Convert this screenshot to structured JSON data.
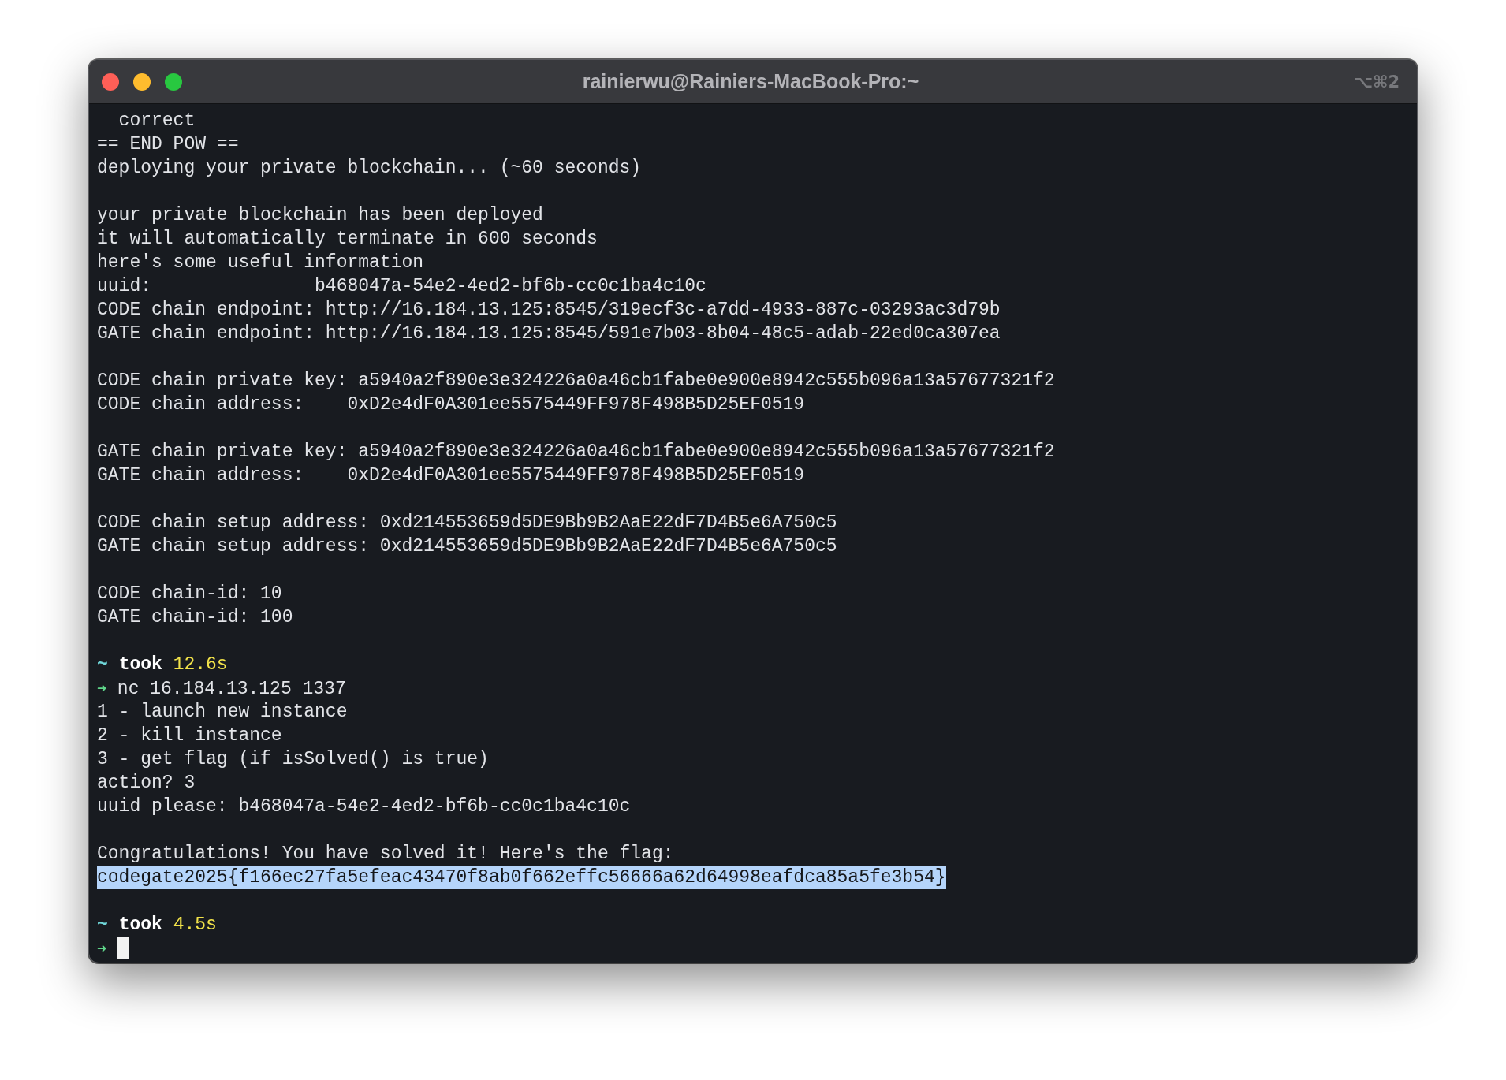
{
  "window": {
    "title": "rainierwu@Rainiers-MacBook-Pro:~",
    "shortcut": "⌥⌘2"
  },
  "terminal": {
    "lines": [
      {
        "kind": "output",
        "text": "  correct",
        "selected": false
      },
      {
        "kind": "output",
        "text": "== END POW ==",
        "selected": false
      },
      {
        "kind": "output",
        "text": "deploying your private blockchain... (~60 seconds)",
        "selected": false
      },
      {
        "kind": "blank"
      },
      {
        "kind": "output",
        "text": "your private blockchain has been deployed",
        "selected": false
      },
      {
        "kind": "output",
        "text": "it will automatically terminate in 600 seconds",
        "selected": false
      },
      {
        "kind": "output",
        "text": "here's some useful information",
        "selected": false
      },
      {
        "kind": "output",
        "text": "uuid:               b468047a-54e2-4ed2-bf6b-cc0c1ba4c10c",
        "selected": false
      },
      {
        "kind": "output",
        "text": "CODE chain endpoint: http://16.184.13.125:8545/319ecf3c-a7dd-4933-887c-03293ac3d79b",
        "selected": false
      },
      {
        "kind": "output",
        "text": "GATE chain endpoint: http://16.184.13.125:8545/591e7b03-8b04-48c5-adab-22ed0ca307ea",
        "selected": false
      },
      {
        "kind": "blank"
      },
      {
        "kind": "output",
        "text": "CODE chain private key: a5940a2f890e3e324226a0a46cb1fabe0e900e8942c555b096a13a57677321f2",
        "selected": false
      },
      {
        "kind": "output",
        "text": "CODE chain address:    0xD2e4dF0A301ee5575449FF978F498B5D25EF0519",
        "selected": false
      },
      {
        "kind": "blank"
      },
      {
        "kind": "output",
        "text": "GATE chain private key: a5940a2f890e3e324226a0a46cb1fabe0e900e8942c555b096a13a57677321f2",
        "selected": false
      },
      {
        "kind": "output",
        "text": "GATE chain address:    0xD2e4dF0A301ee5575449FF978F498B5D25EF0519",
        "selected": false
      },
      {
        "kind": "blank"
      },
      {
        "kind": "output",
        "text": "CODE chain setup address: 0xd214553659d5DE9Bb9B2AaE22dF7D4B5e6A750c5",
        "selected": false
      },
      {
        "kind": "output",
        "text": "GATE chain setup address: 0xd214553659d5DE9Bb9B2AaE22dF7D4B5e6A750c5",
        "selected": false
      },
      {
        "kind": "blank"
      },
      {
        "kind": "output",
        "text": "CODE chain-id: 10",
        "selected": false
      },
      {
        "kind": "output",
        "text": "GATE chain-id: 100",
        "selected": false
      },
      {
        "kind": "blank"
      },
      {
        "kind": "timing",
        "symbol": "~",
        "label": "took",
        "duration": "12.6s"
      },
      {
        "kind": "command",
        "symbol": "➜",
        "text": "nc 16.184.13.125 1337"
      },
      {
        "kind": "output",
        "text": "1 - launch new instance",
        "selected": false
      },
      {
        "kind": "output",
        "text": "2 - kill instance",
        "selected": false
      },
      {
        "kind": "output",
        "text": "3 - get flag (if isSolved() is true)",
        "selected": false
      },
      {
        "kind": "output",
        "text": "action? 3",
        "selected": false
      },
      {
        "kind": "output",
        "text": "uuid please: b468047a-54e2-4ed2-bf6b-cc0c1ba4c10c",
        "selected": false
      },
      {
        "kind": "blank"
      },
      {
        "kind": "output",
        "text": "Congratulations! You have solved it! Here's the flag:",
        "selected": false
      },
      {
        "kind": "output",
        "text": "codegate2025{f166ec27fa5efeac43470f8ab0f662effc56666a62d64998eafdca85a5fe3b54}",
        "selected": true
      },
      {
        "kind": "blank"
      },
      {
        "kind": "timing",
        "symbol": "~",
        "label": "took",
        "duration": "4.5s"
      },
      {
        "kind": "prompt",
        "symbol": "➜",
        "cursor": true
      }
    ]
  }
}
